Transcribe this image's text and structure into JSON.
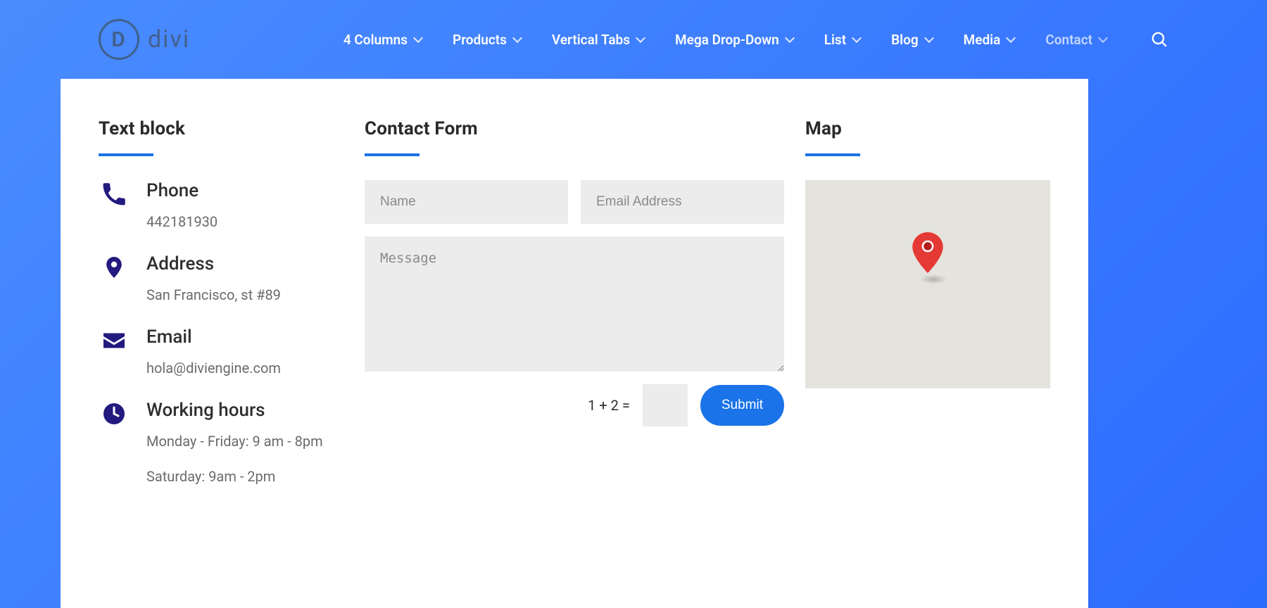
{
  "brand": {
    "mark": "D",
    "name": "divi"
  },
  "nav": {
    "items": [
      {
        "label": "4 Columns"
      },
      {
        "label": "Products"
      },
      {
        "label": "Vertical Tabs"
      },
      {
        "label": "Mega Drop-Down"
      },
      {
        "label": "List"
      },
      {
        "label": "Blog"
      },
      {
        "label": "Media"
      },
      {
        "label": "Contact",
        "active": true
      }
    ]
  },
  "panel": {
    "text_block": {
      "title": "Text block",
      "phone": {
        "label": "Phone",
        "value": "442181930"
      },
      "address": {
        "label": "Address",
        "value": "San Francisco, st #89"
      },
      "email": {
        "label": "Email",
        "value": "hola@diviengine.com"
      },
      "hours": {
        "label": "Working hours",
        "lines": [
          "Monday - Friday: 9 am - 8pm",
          "Saturday: 9am - 2pm"
        ]
      }
    },
    "contact_form": {
      "title": "Contact Form",
      "name_placeholder": "Name",
      "email_placeholder": "Email Address",
      "message_placeholder": "Message",
      "captcha": "1 + 2 =",
      "submit": "Submit"
    },
    "map": {
      "title": "Map"
    }
  }
}
